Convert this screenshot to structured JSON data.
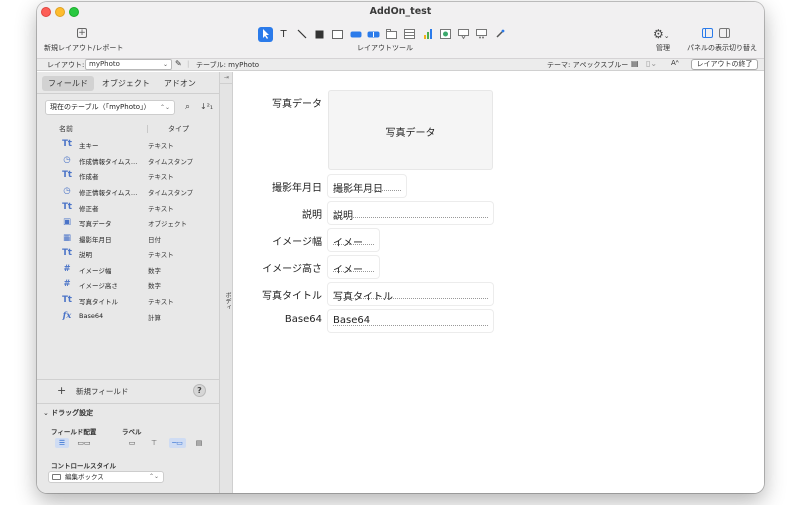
{
  "window": {
    "title": "AddOn_test"
  },
  "toolbar": {
    "new_layout_label": "新規レイアウト/レポート",
    "layout_tools_label": "レイアウトツール",
    "manage_label": "管理",
    "panel_toggle_label": "パネルの表示切り替え"
  },
  "layoutbar": {
    "layout_label": "レイアウト:",
    "layout_value": "myPhoto",
    "table_label": "テーブル: myPhoto",
    "theme_label": "テーマ: アペックスブルー",
    "end_button": "レイアウトの終了"
  },
  "sidebar": {
    "tabs": [
      "フィールド",
      "オブジェクト",
      "アドオン"
    ],
    "table_select": "現在のテーブル（「myPhoto」）",
    "col_name": "名前",
    "col_type": "タイプ",
    "fields": [
      {
        "icon": "Tt",
        "name": "主キー",
        "type": "テキスト"
      },
      {
        "icon": "◷",
        "name": "作成情報タイムス…",
        "type": "タイムスタンプ"
      },
      {
        "icon": "Tt",
        "name": "作成者",
        "type": "テキスト"
      },
      {
        "icon": "◷",
        "name": "修正情報タイムス…",
        "type": "タイムスタンプ"
      },
      {
        "icon": "Tt",
        "name": "修正者",
        "type": "テキスト"
      },
      {
        "icon": "▣",
        "name": "写真データ",
        "type": "オブジェクト"
      },
      {
        "icon": "▦",
        "name": "撮影年月日",
        "type": "日付"
      },
      {
        "icon": "Tt",
        "name": "説明",
        "type": "テキスト"
      },
      {
        "icon": "#",
        "name": "イメージ幅",
        "type": "数字"
      },
      {
        "icon": "#",
        "name": "イメージ高さ",
        "type": "数字"
      },
      {
        "icon": "Tt",
        "name": "写真タイトル",
        "type": "テキスト"
      },
      {
        "icon": "fx",
        "name": "Base64",
        "type": "計算"
      }
    ],
    "new_field": "新規フィールド",
    "help": "?",
    "drag_settings": "ドラッグ設定",
    "field_layout_label": "フィールド配置",
    "label_label": "ラベル",
    "control_style_label": "コントロールスタイル",
    "control_style_value": "編集ボックス"
  },
  "body_strip": {
    "label": "ボディ"
  },
  "canvas": {
    "fields": [
      {
        "label": "写真データ",
        "value": "写真データ"
      },
      {
        "label": "撮影年月日",
        "value": "撮影年月日"
      },
      {
        "label": "説明",
        "value": "説明"
      },
      {
        "label": "イメージ幅",
        "value": "イメー"
      },
      {
        "label": "イメージ高さ",
        "value": "イメー"
      },
      {
        "label": "写真タイトル",
        "value": "写真タイトル"
      },
      {
        "label": "Base64",
        "value": "Base64"
      }
    ]
  },
  "colors": {
    "accent": "#2b7bea",
    "sidebar_bg": "#e8e8e8",
    "field_icon": "#4a73c7"
  }
}
